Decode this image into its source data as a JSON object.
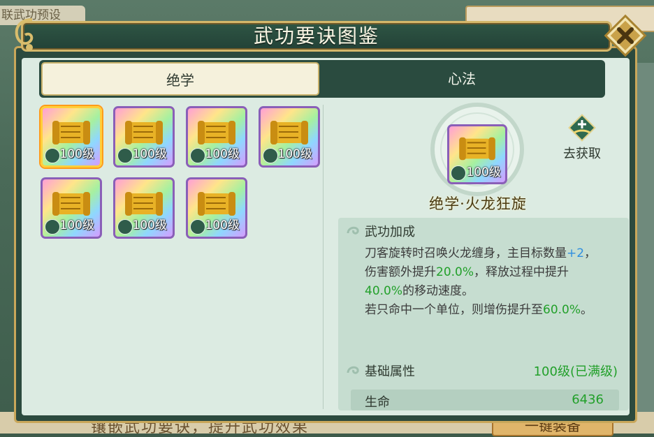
{
  "background": {
    "top_left_text": "联武功预设",
    "bottom_hint": "镶嵌武功要诀，提升武功效果",
    "bottom_button": "一键装备"
  },
  "window": {
    "title": "武功要诀图鉴",
    "close_icon": "close-x-icon"
  },
  "tabs": [
    {
      "label": "绝学",
      "active": true
    },
    {
      "label": "心法",
      "active": false
    }
  ],
  "items": [
    {
      "level": "100级",
      "type_icon": "blade-icon",
      "selected": true
    },
    {
      "level": "100级",
      "type_icon": "spear-icon",
      "selected": false
    },
    {
      "level": "100级",
      "type_icon": "bow-icon",
      "selected": false
    },
    {
      "level": "100级",
      "type_icon": "staff-icon",
      "selected": false
    },
    {
      "level": "100级",
      "type_icon": "sword-icon",
      "selected": false
    },
    {
      "level": "100级",
      "type_icon": "dagger-icon",
      "selected": false
    },
    {
      "level": "100级",
      "type_icon": "fan-icon",
      "selected": false
    }
  ],
  "detail": {
    "item_level": "100级",
    "obtain_label": "去获取",
    "name": "绝学·火龙狂旋",
    "effect_title": "武功加成",
    "desc_parts": {
      "p1": "刀客旋转时召唤火龙缠身，主目标数量",
      "v1": "+2",
      "p2": "，伤害额外提升",
      "v2": "20.0%",
      "p3": "，释放过程中提升",
      "v3": "40.0%",
      "p4": "的移动速度。",
      "p5": "若只命中一个单位，则增伤提升至",
      "v4": "60.0%",
      "p6": "。"
    },
    "base_title": "基础属性",
    "base_level": "100级(已满级)",
    "attr_name": "生命",
    "attr_value": "6436"
  },
  "colors": {
    "header_green": "#2e5544",
    "gold_border": "#c9a75a",
    "highlight_blue": "#2f8fe0",
    "highlight_green": "#22a02a"
  }
}
